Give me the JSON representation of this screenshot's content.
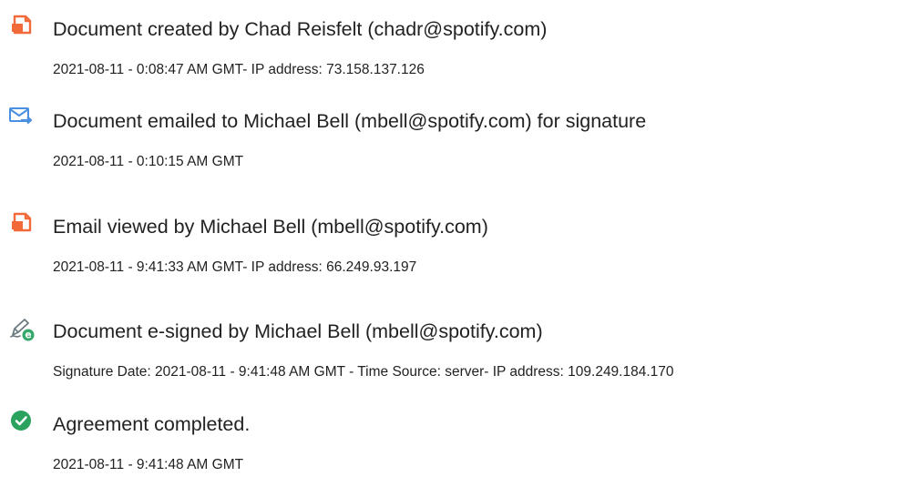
{
  "events": [
    {
      "icon": "document-created-icon",
      "title": "Document created by Chad Reisfelt (chadr@spotify.com)",
      "detail": "2021-08-11 - 0:08:47 AM GMT- IP address: 73.158.137.126"
    },
    {
      "icon": "email-sent-icon",
      "title": "Document emailed to Michael Bell (mbell@spotify.com) for signature",
      "detail": "2021-08-11 - 0:10:15 AM GMT"
    },
    {
      "icon": "email-viewed-icon",
      "title": "Email viewed by Michael Bell (mbell@spotify.com)",
      "detail": "2021-08-11 - 9:41:33 AM GMT- IP address: 66.249.93.197"
    },
    {
      "icon": "e-signed-icon",
      "title": "Document e-signed by Michael Bell (mbell@spotify.com)",
      "detail": "Signature Date: 2021-08-11 - 9:41:48 AM GMT - Time Source: server- IP address: 109.249.184.170"
    },
    {
      "icon": "checkmark-circle-icon",
      "title": "Agreement completed.",
      "detail": "2021-08-11 - 9:41:48 AM GMT"
    }
  ],
  "colors": {
    "document_icon": "#f2693a",
    "email_icon": "#4a8fe0",
    "sign_icon": "#34a86a",
    "complete_icon": "#2ca25f",
    "text": "#222222"
  }
}
